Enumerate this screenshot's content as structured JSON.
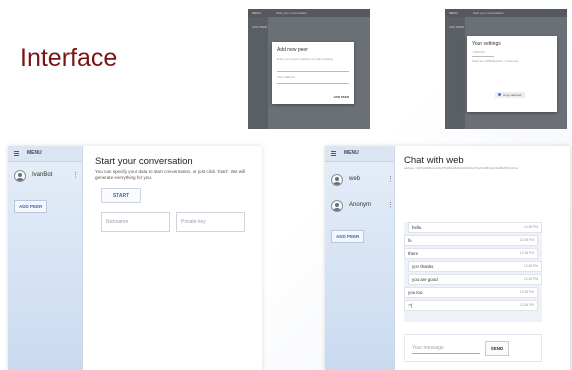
{
  "slide": {
    "title": "Interface"
  },
  "thumb_add_peer": {
    "top_text": "Start your conversation",
    "menu": "MENU",
    "add_peer": "ADD PEER",
    "dialog_title": "Add new peer",
    "dialog_hint": "Enter your peer's address to start chatting",
    "field_placeholder": "Peer address",
    "action": "ADD PEER"
  },
  "thumb_settings": {
    "top_text": "Start your conversation",
    "menu": "MENU",
    "add_peer": "ADD PEER",
    "dialog_title": "Your settings",
    "nickname": "ANONYM",
    "fields_text": "Public key: 0358d4a1e9c2... Private key: ...",
    "chip": "Copy address"
  },
  "start_panel": {
    "menu": "MENU",
    "peers": [
      {
        "name": "IvanBot"
      }
    ],
    "add_peer": "ADD PEER",
    "title": "Start your conversation",
    "subtitle": "You can specify your data to start conversation, or just click 'Start'. We will generate everything for you.",
    "start_button": "START",
    "nickname_placeholder": "Nickname",
    "private_key_placeholder": "Private key"
  },
  "chat_panel": {
    "menu": "MENU",
    "peers": [
      {
        "name": "web"
      },
      {
        "name": "Anonym"
      }
    ],
    "add_peer": "ADD PEER",
    "title": "Chat with web",
    "address": "address: 03c5a4f08b2e1c9a7f5d3b1e8c6a4f2d0b9e7c5a3f1d8b6e4c2a0f9d7b5e3c1a",
    "messages": [
      {
        "text": "hello",
        "time": "12:38 PM",
        "side": "right"
      },
      {
        "text": "hi",
        "time": "12:38 PM",
        "side": "left"
      },
      {
        "text": "there",
        "time": "12:38 PM",
        "side": "left"
      },
      {
        "text": "yo> thanks",
        "time": "12:38 PM",
        "side": "right"
      },
      {
        "text": "you are good",
        "time": "12:38 PM",
        "side": "right"
      },
      {
        "text": "you too",
        "time": "12:38 PM",
        "side": "left"
      },
      {
        "text": ":*)",
        "time": "12:38 PM",
        "side": "left"
      }
    ],
    "composer_placeholder": "Your message",
    "send_button": "SEND"
  }
}
